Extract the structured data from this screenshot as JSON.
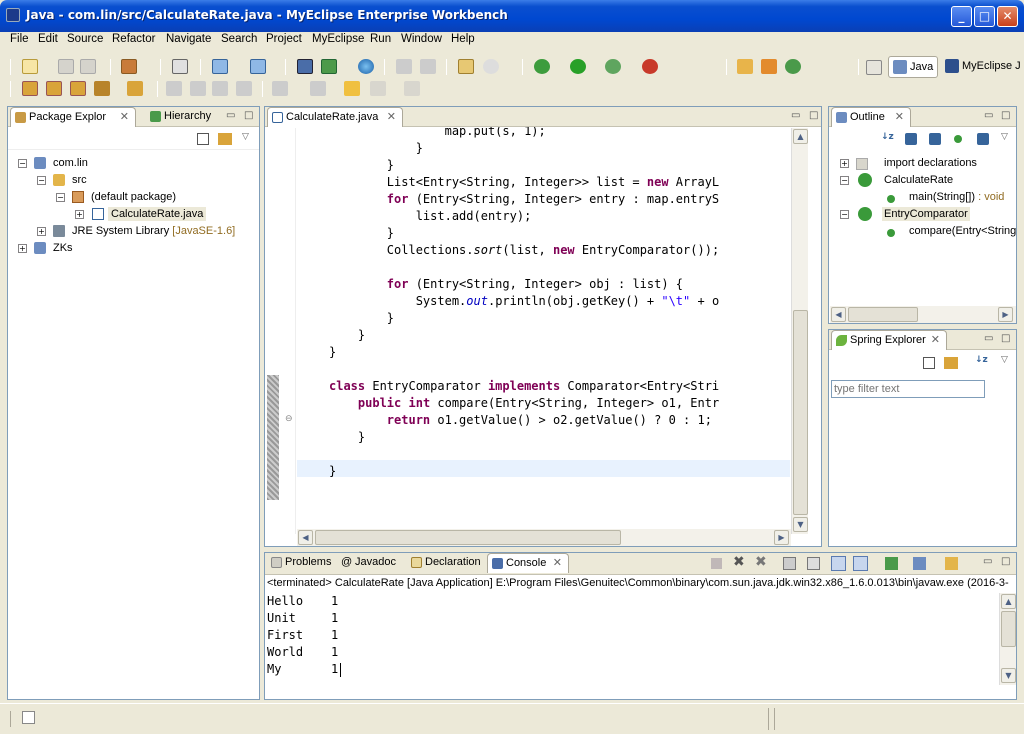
{
  "window": {
    "title": "Java - com.lin/src/CalculateRate.java - MyEclipse Enterprise Workbench",
    "min": "_",
    "max": "□",
    "close": "✕"
  },
  "menu": [
    "File",
    "Edit",
    "Source",
    "Refactor",
    "Navigate",
    "Search",
    "Project",
    "MyEclipse",
    "Run",
    "Window",
    "Help"
  ],
  "perspectives": {
    "java": "Java",
    "myeclipse": "MyEclipse J"
  },
  "package_explorer": {
    "tabs": [
      "Package Explor",
      "Hierarchy"
    ],
    "tree": {
      "project": "com.lin",
      "src": "src",
      "package": "(default package)",
      "file": "CalculateRate.java",
      "jre": "JRE System Library",
      "jre_version": "[JavaSE-1.6]",
      "zks": "ZKs"
    }
  },
  "editor": {
    "tab": "CalculateRate.java",
    "lines": [
      "                map.put(s, 1);",
      "            }",
      "        }",
      "        List<Entry<String, Integer>> list = new ArrayL",
      "        for (Entry<String, Integer> entry : map.entryS",
      "            list.add(entry);",
      "        }",
      "        Collections.sort(list, new EntryComparator());",
      "",
      "        for (Entry<String, Integer> obj : list) {",
      "            System.out.println(obj.getKey() + \"\\t\" + o",
      "        }",
      "    }",
      "}",
      "",
      "class EntryComparator implements Comparator<Entry<Stri",
      "    public int compare(Entry<String, Integer> o1, Entr",
      "        return o1.getValue() > o2.getValue() ? 0 : 1;",
      "    }",
      "",
      "}"
    ]
  },
  "outline": {
    "tab": "Outline",
    "items": {
      "imports": "import declarations",
      "class1": "CalculateRate",
      "main": "main(String[])",
      "main_type": ": void",
      "class2": "EntryComparator",
      "compare": "compare(Entry<String"
    }
  },
  "spring": {
    "tab": "Spring Explorer",
    "filter_placeholder": "type filter text"
  },
  "bottom": {
    "tabs": [
      "Problems",
      "Javadoc",
      "Declaration",
      "Console"
    ],
    "status": "<terminated> CalculateRate [Java Application] E:\\Program Files\\Genuitec\\Common\\binary\\com.sun.java.jdk.win32.x86_1.6.0.013\\bin\\javaw.exe (2016-3-",
    "output": [
      {
        "word": "Hello",
        "count": "1"
      },
      {
        "word": "Unit",
        "count": "1"
      },
      {
        "word": "First",
        "count": "1"
      },
      {
        "word": "World",
        "count": "1"
      },
      {
        "word": "My",
        "count": "1"
      }
    ]
  },
  "colors": {
    "keyword": "#7f0055",
    "static_field": "#0000c0",
    "string": "#2a00ff",
    "title_bar": "#0048d0"
  }
}
